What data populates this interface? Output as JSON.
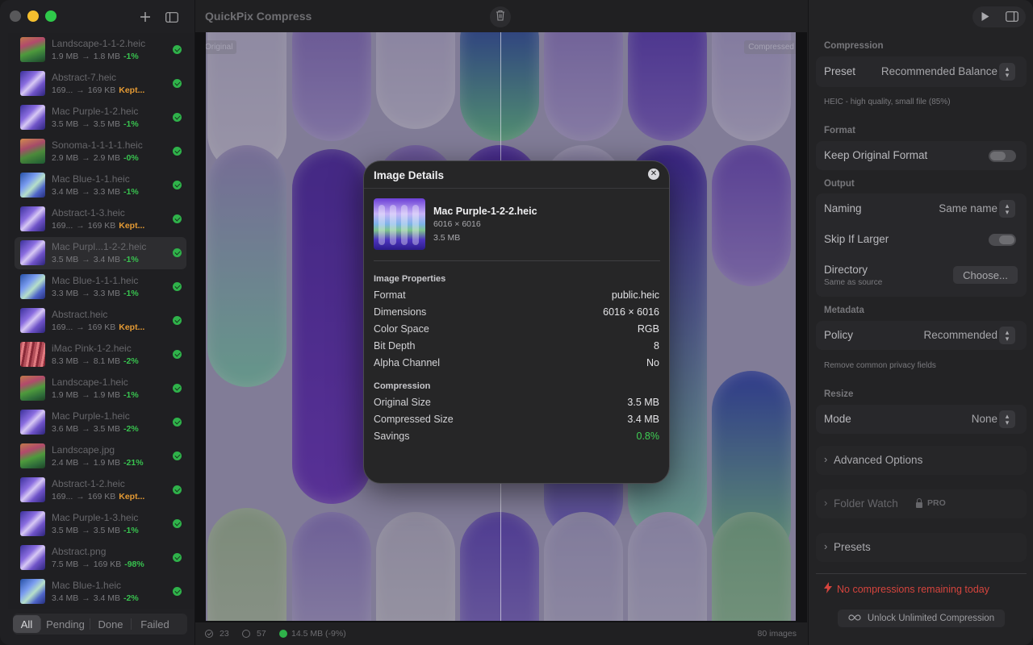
{
  "app": {
    "title": "QuickPix Compress"
  },
  "sidebar": {
    "files": [
      {
        "name": "Landscape-1-1-2.heic",
        "from": "1.9 MB",
        "to": "1.8 MB",
        "pct": "-1%",
        "pct_style": "green",
        "thumb": "landscape"
      },
      {
        "name": "Abstract-7.heic",
        "from": "169...",
        "to": "169 KB",
        "pct": "Kept...",
        "pct_style": "orange",
        "thumb": "purple"
      },
      {
        "name": "Mac Purple-1-2.heic",
        "from": "3.5 MB",
        "to": "3.5 MB",
        "pct": "-1%",
        "pct_style": "green",
        "thumb": "purple"
      },
      {
        "name": "Sonoma-1-1-1-1.heic",
        "from": "2.9 MB",
        "to": "2.9 MB",
        "pct": "-0%",
        "pct_style": "green",
        "thumb": "sonoma"
      },
      {
        "name": "Mac Blue-1-1.heic",
        "from": "3.4 MB",
        "to": "3.3 MB",
        "pct": "-1%",
        "pct_style": "green",
        "thumb": "blue"
      },
      {
        "name": "Abstract-1-3.heic",
        "from": "169...",
        "to": "169 KB",
        "pct": "Kept...",
        "pct_style": "orange",
        "thumb": "purple"
      },
      {
        "name": "Mac Purpl...1-2-2.heic",
        "from": "3.5 MB",
        "to": "3.4 MB",
        "pct": "-1%",
        "pct_style": "green",
        "thumb": "purple",
        "selected": true
      },
      {
        "name": "Mac Blue-1-1-1.heic",
        "from": "3.3 MB",
        "to": "3.3 MB",
        "pct": "-1%",
        "pct_style": "green",
        "thumb": "blue"
      },
      {
        "name": "Abstract.heic",
        "from": "169...",
        "to": "169 KB",
        "pct": "Kept...",
        "pct_style": "orange",
        "thumb": "purple"
      },
      {
        "name": "iMac Pink-1-2.heic",
        "from": "8.3 MB",
        "to": "8.1 MB",
        "pct": "-2%",
        "pct_style": "green",
        "thumb": "pink"
      },
      {
        "name": "Landscape-1.heic",
        "from": "1.9 MB",
        "to": "1.9 MB",
        "pct": "-1%",
        "pct_style": "green",
        "thumb": "landscape"
      },
      {
        "name": "Mac Purple-1.heic",
        "from": "3.6 MB",
        "to": "3.5 MB",
        "pct": "-2%",
        "pct_style": "green",
        "thumb": "purple"
      },
      {
        "name": "Landscape.jpg",
        "from": "2.4 MB",
        "to": "1.9 MB",
        "pct": "-21%",
        "pct_style": "green",
        "thumb": "landscape"
      },
      {
        "name": "Abstract-1-2.heic",
        "from": "169...",
        "to": "169 KB",
        "pct": "Kept...",
        "pct_style": "orange",
        "thumb": "purple"
      },
      {
        "name": "Mac Purple-1-3.heic",
        "from": "3.5 MB",
        "to": "3.5 MB",
        "pct": "-1%",
        "pct_style": "green",
        "thumb": "purple"
      },
      {
        "name": "Abstract.png",
        "from": "7.5 MB",
        "to": "169 KB",
        "pct": "-98%",
        "pct_style": "green",
        "thumb": "purple"
      },
      {
        "name": "Mac Blue-1.heic",
        "from": "3.4 MB",
        "to": "3.4 MB",
        "pct": "-2%",
        "pct_style": "green",
        "thumb": "blue"
      }
    ],
    "filters": [
      "All",
      "Pending",
      "Done",
      "Failed"
    ],
    "active_filter": "All"
  },
  "preview": {
    "left_tag": "Original",
    "right_tag": "Compressed"
  },
  "status": {
    "done_count": "23",
    "pending_count": "57",
    "saved": "14.5 MB (-9%)",
    "total": "80 images"
  },
  "panel": {
    "compression_label": "Compression",
    "preset_label": "Preset",
    "preset_value": "Recommended Balance",
    "preset_hint": "HEIC - high quality, small file (85%)",
    "format_label": "Format",
    "keep_format_label": "Keep Original Format",
    "keep_format_on": false,
    "output_label": "Output",
    "naming_label": "Naming",
    "naming_value": "Same name",
    "skip_larger_label": "Skip If Larger",
    "skip_larger_on": true,
    "directory_label": "Directory",
    "directory_hint": "Same as source",
    "choose_label": "Choose...",
    "metadata_label": "Metadata",
    "policy_label": "Policy",
    "policy_value": "Recommended",
    "policy_hint": "Remove common privacy fields",
    "resize_label": "Resize",
    "mode_label": "Mode",
    "mode_value": "None",
    "advanced_label": "Advanced Options",
    "folder_watch_label": "Folder Watch",
    "pro_label": "PRO",
    "presets_label": "Presets",
    "warning": "No compressions remaining today",
    "unlock_label": "Unlock Unlimited Compression"
  },
  "modal": {
    "title": "Image Details",
    "file_name": "Mac Purple-1-2-2.heic",
    "dimensions": "6016 × 6016",
    "size": "3.5 MB",
    "props_header": "Image Properties",
    "props": [
      {
        "label": "Format",
        "value": "public.heic"
      },
      {
        "label": "Dimensions",
        "value": "6016 × 6016"
      },
      {
        "label": "Color Space",
        "value": "RGB"
      },
      {
        "label": "Bit Depth",
        "value": "8"
      },
      {
        "label": "Alpha Channel",
        "value": "No"
      }
    ],
    "comp_header": "Compression",
    "comp": [
      {
        "label": "Original Size",
        "value": "3.5 MB"
      },
      {
        "label": "Compressed Size",
        "value": "3.4 MB"
      },
      {
        "label": "Savings",
        "value": "0.8%"
      }
    ]
  },
  "colors": {
    "accent_green": "#3fcf54",
    "kept_orange": "#e49a34",
    "warning_red": "#d5443d"
  }
}
